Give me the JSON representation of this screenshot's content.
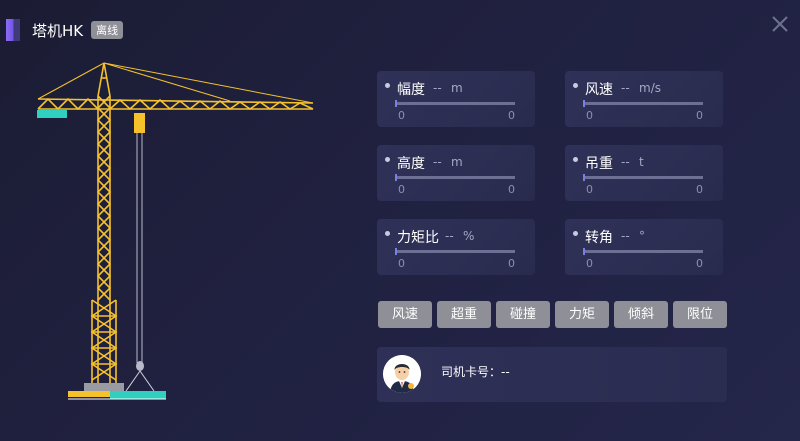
{
  "header": {
    "title": "塔机HK",
    "status_badge": "离线"
  },
  "metrics": [
    {
      "label": "幅度",
      "value": "--",
      "unit": "m",
      "min": "0",
      "max": "0"
    },
    {
      "label": "风速",
      "value": "--",
      "unit": "m/s",
      "min": "0",
      "max": "0"
    },
    {
      "label": "高度",
      "value": "--",
      "unit": "m",
      "min": "0",
      "max": "0"
    },
    {
      "label": "吊重",
      "value": "--",
      "unit": "t",
      "min": "0",
      "max": "0"
    },
    {
      "label": "力矩比",
      "value": "--",
      "unit": "%",
      "min": "0",
      "max": "0"
    },
    {
      "label": "转角",
      "value": "--",
      "unit": "°",
      "min": "0",
      "max": "0"
    }
  ],
  "alarms": [
    "风速",
    "超重",
    "碰撞",
    "力矩",
    "倾斜",
    "限位"
  ],
  "driver": {
    "card_label": "司机卡号：",
    "card_value": "--"
  },
  "colors": {
    "crane": "#f5c22c",
    "counterweight": "#2fd0c0",
    "alarm_button": "#8e8f97",
    "accent": "#7b5ff0"
  },
  "icons": {
    "close": "close-icon",
    "avatar": "driver-avatar-icon"
  }
}
